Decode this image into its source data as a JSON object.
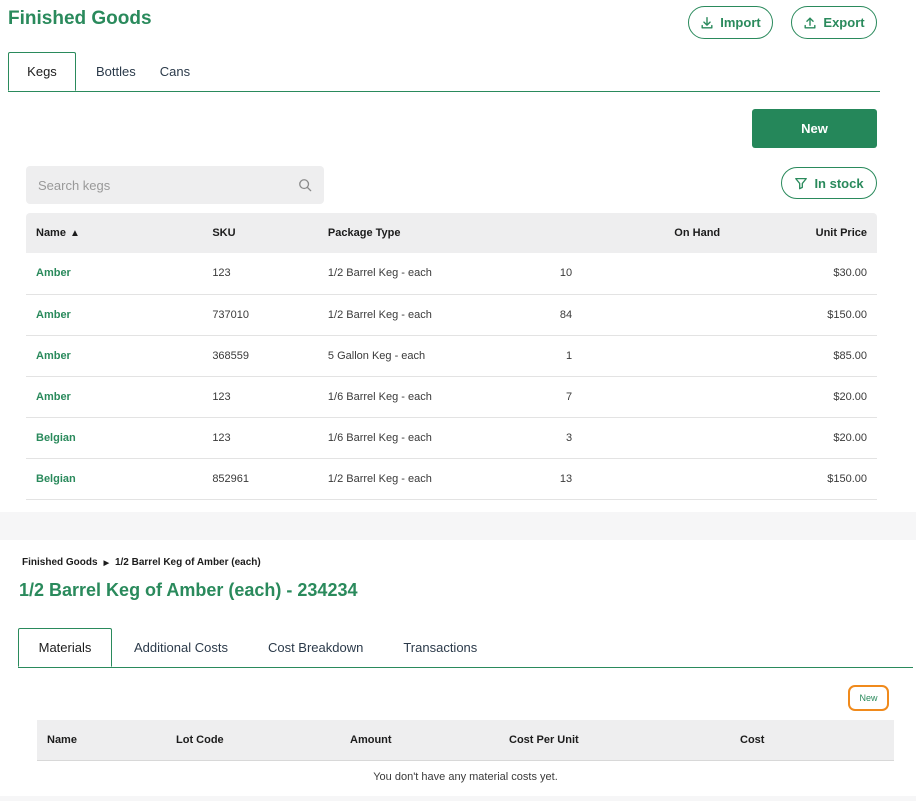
{
  "header": {
    "title": "Finished Goods",
    "import_label": "Import",
    "export_label": "Export"
  },
  "tabs": [
    {
      "label": "Kegs",
      "active": true
    },
    {
      "label": "Bottles",
      "active": false
    },
    {
      "label": "Cans",
      "active": false
    }
  ],
  "new_button_label": "New",
  "search": {
    "placeholder": "Search kegs",
    "value": ""
  },
  "filter_label": "In stock",
  "kegs_table": {
    "columns": [
      "Name",
      "SKU",
      "Package Type",
      "On Hand",
      "Unit Price"
    ],
    "sorted_column": "Name",
    "sort_direction": "ascending",
    "rows": [
      {
        "name": "Amber",
        "sku": "123",
        "package_type": "1/2 Barrel Keg - each",
        "on_hand": "10",
        "unit_price": "$30.00"
      },
      {
        "name": "Amber",
        "sku": "737010",
        "package_type": "1/2 Barrel Keg - each",
        "on_hand": "84",
        "unit_price": "$150.00"
      },
      {
        "name": "Amber",
        "sku": "368559",
        "package_type": "5 Gallon Keg - each",
        "on_hand": "1",
        "unit_price": "$85.00"
      },
      {
        "name": "Amber",
        "sku": "123",
        "package_type": "1/6 Barrel Keg - each",
        "on_hand": "7",
        "unit_price": "$20.00"
      },
      {
        "name": "Belgian",
        "sku": "123",
        "package_type": "1/6 Barrel Keg - each",
        "on_hand": "3",
        "unit_price": "$20.00"
      },
      {
        "name": "Belgian",
        "sku": "852961",
        "package_type": "1/2 Barrel Keg - each",
        "on_hand": "13",
        "unit_price": "$150.00"
      }
    ]
  },
  "detail": {
    "breadcrumb": [
      "Finished Goods",
      "1/2 Barrel Keg of Amber (each)"
    ],
    "title": "1/2 Barrel Keg of Amber (each) - 234234",
    "tabs": [
      {
        "label": "Materials",
        "active": true
      },
      {
        "label": "Additional Costs",
        "active": false
      },
      {
        "label": "Cost Breakdown",
        "active": false
      },
      {
        "label": "Transactions",
        "active": false
      }
    ],
    "new_label": "New",
    "materials_table": {
      "columns": [
        "Name",
        "Lot Code",
        "Amount",
        "Cost Per Unit",
        "Cost"
      ],
      "empty_message": "You don't have any material costs yet."
    }
  },
  "colors": {
    "brand_green": "#2a8a5c",
    "button_green": "#25875a",
    "highlight_orange": "#f08a1c",
    "table_header_bg": "#eeeeef"
  },
  "icons": {
    "import": "download-icon",
    "export": "upload-icon",
    "search": "search-icon",
    "filter": "filter-icon",
    "sort": "sort-up-icon",
    "breadcrumb_separator": "caret-right-icon"
  }
}
